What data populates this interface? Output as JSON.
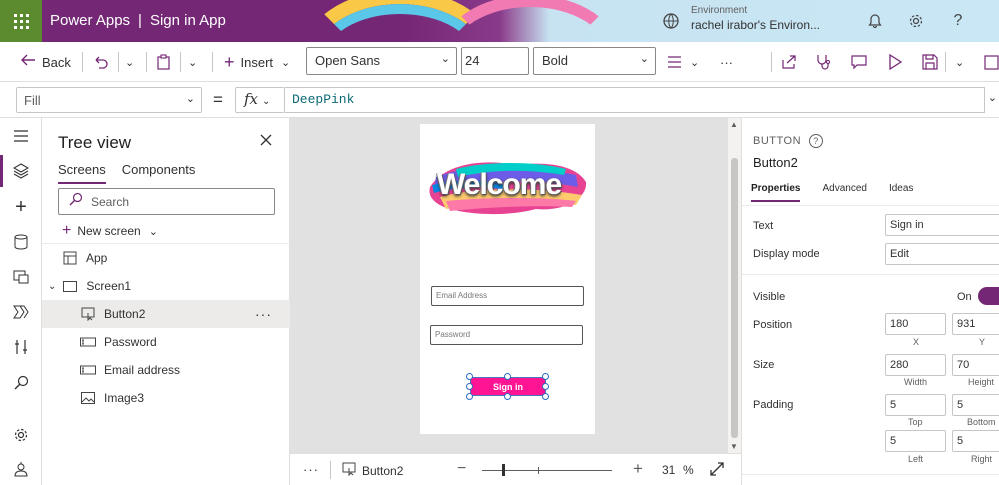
{
  "header": {
    "app_name": "Power Apps",
    "separator": "|",
    "doc_title": "Sign in App",
    "env_label": "Environment",
    "env_name": "rachel irabor's Environ...",
    "icons": [
      "waffle-icon",
      "environment-icon",
      "bell-icon",
      "gear-icon",
      "help-icon"
    ]
  },
  "command_bar": {
    "back_label": "Back",
    "insert_label": "Insert",
    "font_family": "Open Sans",
    "font_size": "24",
    "font_weight": "Bold",
    "more_label": "···"
  },
  "formula_bar": {
    "property": "Fill",
    "equals": "=",
    "fx_label": "fx",
    "formula": "DeepPink"
  },
  "tree_view": {
    "title": "Tree view",
    "tabs": [
      "Screens",
      "Components"
    ],
    "search_placeholder": "Search",
    "new_screen_label": "New screen",
    "nodes": [
      {
        "label": "App"
      },
      {
        "label": "Screen1"
      },
      {
        "label": "Button2"
      },
      {
        "label": "Password"
      },
      {
        "label": "Email address"
      },
      {
        "label": "Image3"
      }
    ],
    "more_label": "···"
  },
  "canvas": {
    "welcome_text": "Welcome",
    "email_placeholder": "Email Address",
    "password_placeholder": "Password",
    "button_text": "Sign in",
    "button_color": "#FF1493"
  },
  "bottom_bar": {
    "dots": "···",
    "selected_control": "Button2",
    "zoom_value": "31",
    "zoom_unit": "%"
  },
  "properties": {
    "control_type": "BUTTON",
    "control_name": "Button2",
    "tabs": [
      "Properties",
      "Advanced",
      "Ideas"
    ],
    "text_label": "Text",
    "text_value": "Sign in",
    "display_mode_label": "Display mode",
    "display_mode_value": "Edit",
    "visible_label": "Visible",
    "visible_value": "On",
    "position_label": "Position",
    "position_x": "180",
    "position_y": "931",
    "x_label": "X",
    "y_label": "Y",
    "size_label": "Size",
    "size_width": "280",
    "size_height": "70",
    "width_label": "Width",
    "height_label": "Height",
    "padding_label": "Padding",
    "padding_top": "5",
    "padding_bottom": "5",
    "padding_left": "5",
    "padding_right": "5",
    "top_label": "Top",
    "bottom_label": "Bottom",
    "left_label": "Left",
    "right_label": "Right"
  },
  "colors": {
    "accent": "#742774",
    "deep_pink": "#FF1493"
  }
}
